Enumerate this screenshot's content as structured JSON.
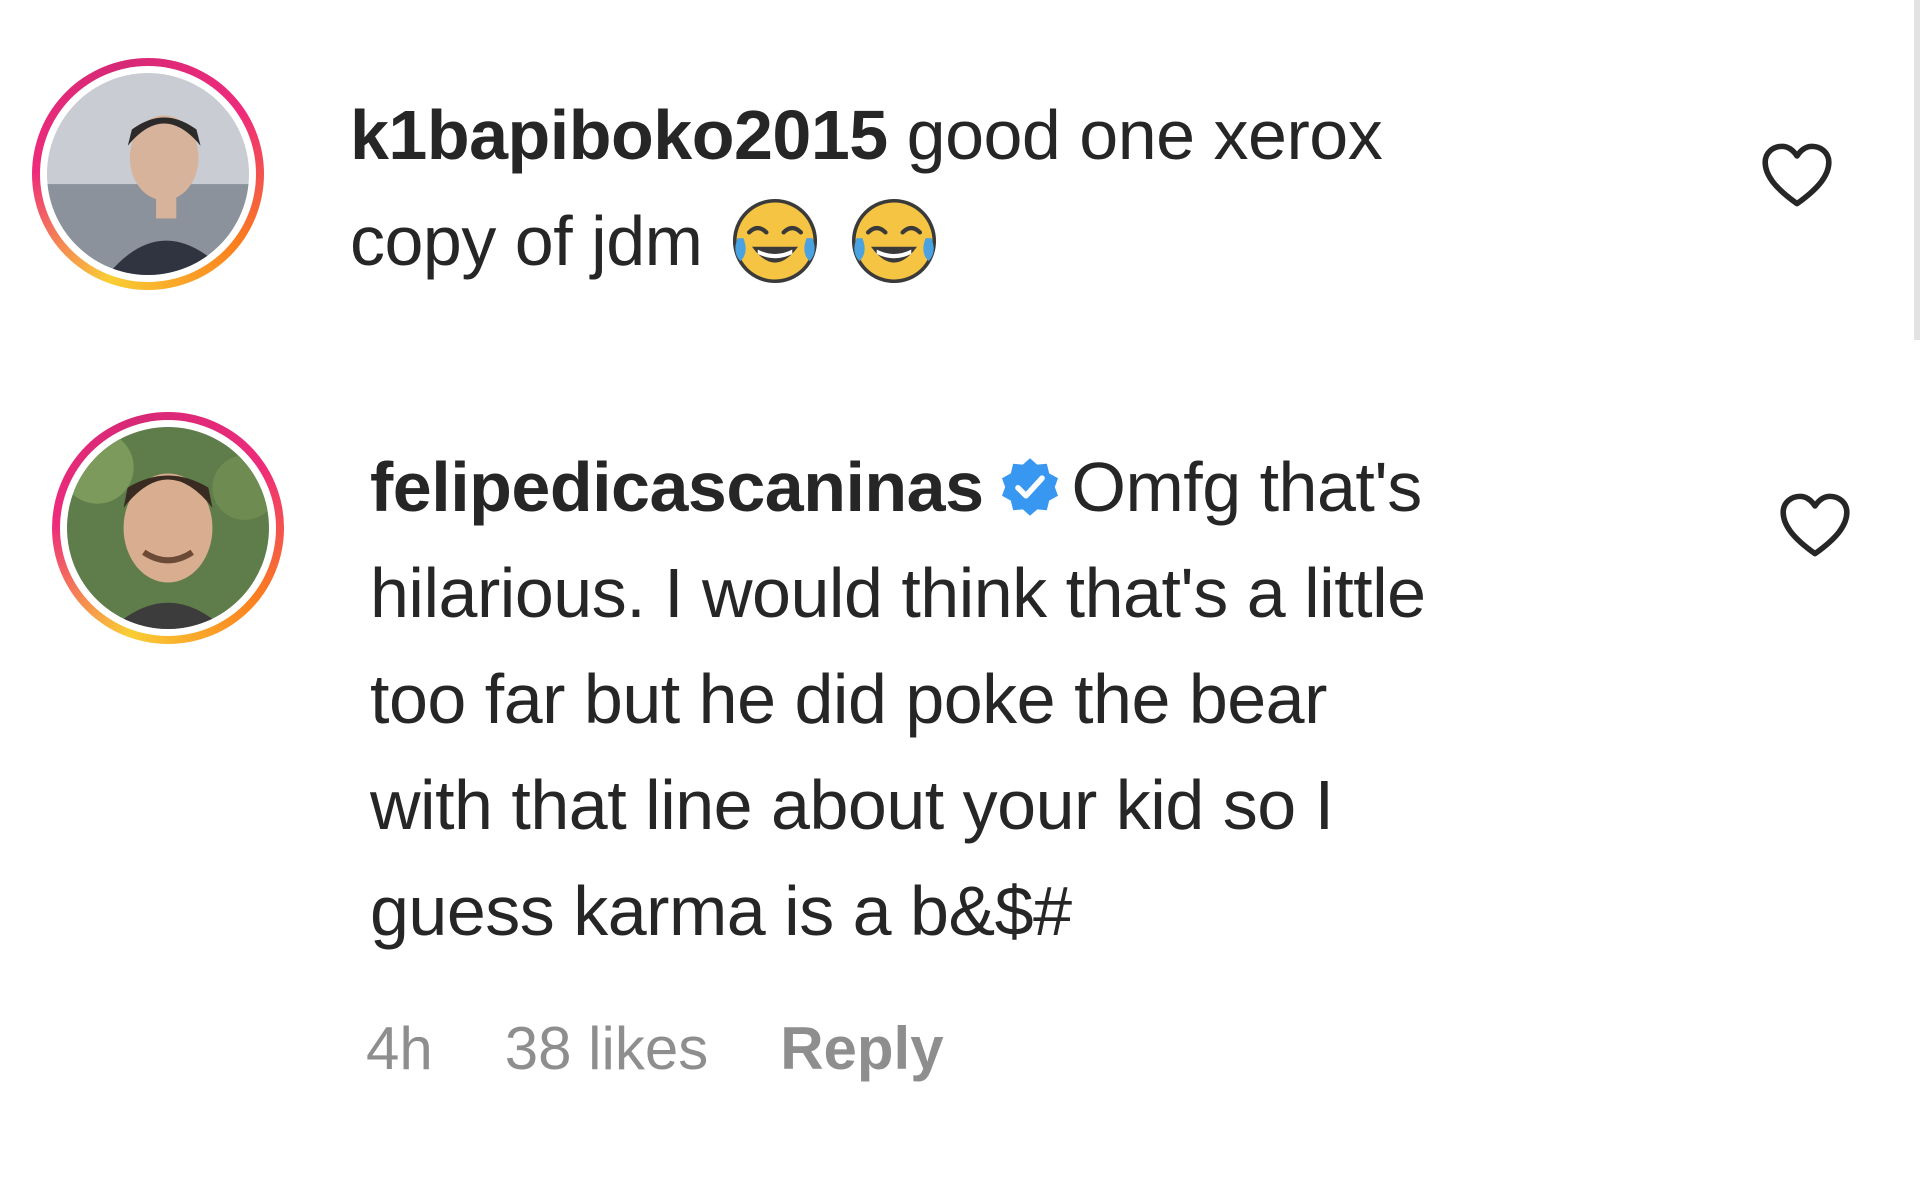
{
  "comments": [
    {
      "username": "k1bapiboko2015",
      "verified": false,
      "text": "good one xerox",
      "text_line2": "copy of jdm",
      "emojis": [
        "tears-of-joy",
        "tears-of-joy"
      ]
    },
    {
      "username": "felipedicascaninas",
      "verified": true,
      "text_line1": "Omfg that's",
      "text_lines": [
        "hilarious. I would think that's a little",
        "too far but he did poke the bear",
        "with that line about your kid so I",
        "guess karma is a b&$#"
      ],
      "time": "4h",
      "likes": "38 likes",
      "reply_label": "Reply"
    }
  ],
  "colors": {
    "text": "#262626",
    "meta": "#8e8e8e",
    "verified": "#3897f0"
  }
}
